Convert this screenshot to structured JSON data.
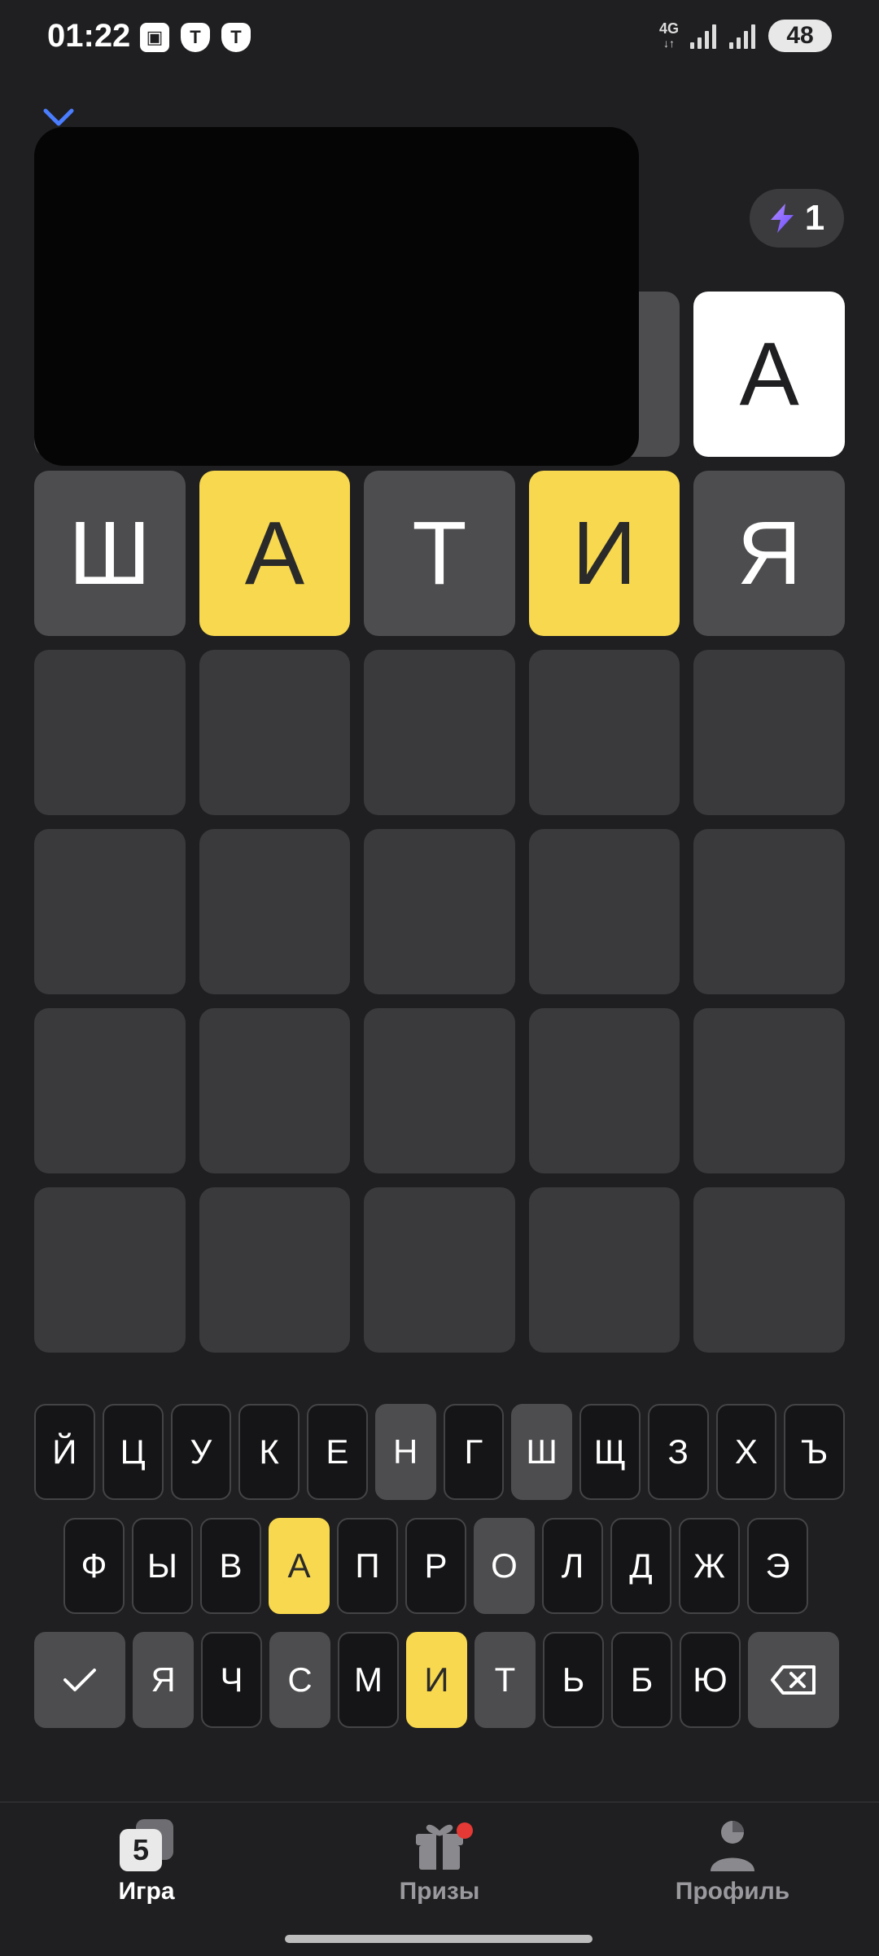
{
  "status_bar": {
    "time": "01:22",
    "network": "4G",
    "battery": "48"
  },
  "energy": {
    "count": "1"
  },
  "board": {
    "rows": [
      [
        {
          "letter": "",
          "state": "hidden"
        },
        {
          "letter": "",
          "state": "hidden"
        },
        {
          "letter": "",
          "state": "hidden"
        },
        {
          "letter": "",
          "state": "hidden"
        },
        {
          "letter": "А",
          "state": "typed"
        }
      ],
      [
        {
          "letter": "Ш",
          "state": "miss"
        },
        {
          "letter": "А",
          "state": "present"
        },
        {
          "letter": "Т",
          "state": "miss"
        },
        {
          "letter": "И",
          "state": "present"
        },
        {
          "letter": "Я",
          "state": "miss"
        }
      ],
      [
        {
          "letter": "",
          "state": "empty"
        },
        {
          "letter": "",
          "state": "empty"
        },
        {
          "letter": "",
          "state": "empty"
        },
        {
          "letter": "",
          "state": "empty"
        },
        {
          "letter": "",
          "state": "empty"
        }
      ],
      [
        {
          "letter": "",
          "state": "empty"
        },
        {
          "letter": "",
          "state": "empty"
        },
        {
          "letter": "",
          "state": "empty"
        },
        {
          "letter": "",
          "state": "empty"
        },
        {
          "letter": "",
          "state": "empty"
        }
      ],
      [
        {
          "letter": "",
          "state": "empty"
        },
        {
          "letter": "",
          "state": "empty"
        },
        {
          "letter": "",
          "state": "empty"
        },
        {
          "letter": "",
          "state": "empty"
        },
        {
          "letter": "",
          "state": "empty"
        }
      ],
      [
        {
          "letter": "",
          "state": "empty"
        },
        {
          "letter": "",
          "state": "empty"
        },
        {
          "letter": "",
          "state": "empty"
        },
        {
          "letter": "",
          "state": "empty"
        },
        {
          "letter": "",
          "state": "empty"
        }
      ]
    ]
  },
  "keyboard": {
    "row1": [
      {
        "k": "Й",
        "s": ""
      },
      {
        "k": "Ц",
        "s": ""
      },
      {
        "k": "У",
        "s": ""
      },
      {
        "k": "К",
        "s": ""
      },
      {
        "k": "Е",
        "s": ""
      },
      {
        "k": "Н",
        "s": "miss"
      },
      {
        "k": "Г",
        "s": ""
      },
      {
        "k": "Ш",
        "s": "miss"
      },
      {
        "k": "Щ",
        "s": ""
      },
      {
        "k": "З",
        "s": ""
      },
      {
        "k": "Х",
        "s": ""
      },
      {
        "k": "Ъ",
        "s": ""
      }
    ],
    "row2": [
      {
        "k": "Ф",
        "s": ""
      },
      {
        "k": "Ы",
        "s": ""
      },
      {
        "k": "В",
        "s": ""
      },
      {
        "k": "А",
        "s": "present"
      },
      {
        "k": "П",
        "s": ""
      },
      {
        "k": "Р",
        "s": ""
      },
      {
        "k": "О",
        "s": "miss"
      },
      {
        "k": "Л",
        "s": ""
      },
      {
        "k": "Д",
        "s": ""
      },
      {
        "k": "Ж",
        "s": ""
      },
      {
        "k": "Э",
        "s": ""
      }
    ],
    "row3": [
      {
        "k": "Я",
        "s": "miss"
      },
      {
        "k": "Ч",
        "s": ""
      },
      {
        "k": "С",
        "s": "miss"
      },
      {
        "k": "М",
        "s": ""
      },
      {
        "k": "И",
        "s": "present"
      },
      {
        "k": "Т",
        "s": "miss"
      },
      {
        "k": "Ь",
        "s": ""
      },
      {
        "k": "Б",
        "s": ""
      },
      {
        "k": "Ю",
        "s": ""
      }
    ]
  },
  "nav": {
    "game": "Игра",
    "prizes": "Призы",
    "profile": "Профиль"
  },
  "colors": {
    "background": "#1f1f21",
    "present": "#f8d84e",
    "miss": "#4d4d4f",
    "empty": "#3a3a3c",
    "accent": "#4a7dff",
    "badge": "#e53935"
  },
  "icons": {
    "close": "close-icon",
    "energy": "lightning-icon",
    "enter": "checkmark-icon",
    "backspace": "backspace-icon",
    "game": "game-logo-icon",
    "prizes": "gift-icon",
    "profile": "profile-icon"
  }
}
